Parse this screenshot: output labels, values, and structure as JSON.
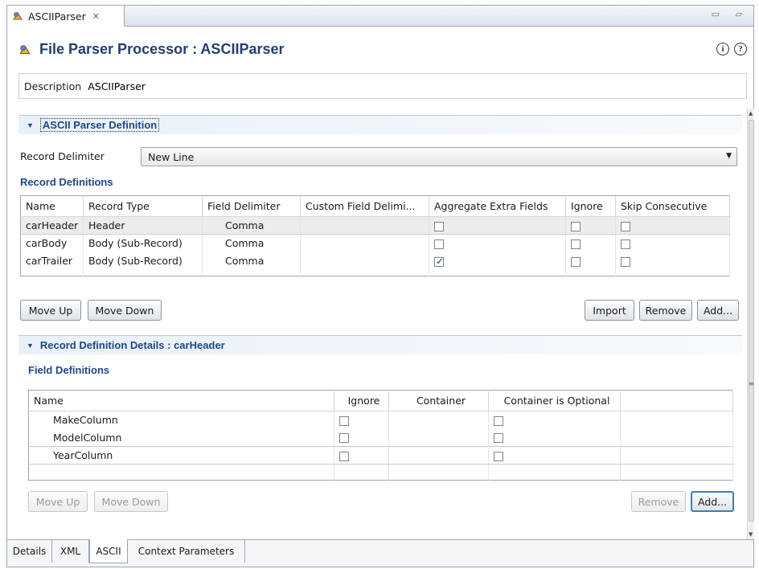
{
  "editor_tab": {
    "label": "ASCIIParser",
    "close_glyph": "✕"
  },
  "window_controls": "▭ ▱",
  "header": {
    "title": "File Parser Processor : ASCIIParser",
    "info_glyph": "i",
    "help_glyph": "?"
  },
  "description": {
    "label": "Description",
    "value": "ASCIIParser"
  },
  "ascii_section": {
    "title": "ASCII Parser Definition",
    "delimiter_label": "Record Delimiter",
    "delimiter_value": "New Line",
    "record_defs_title": "Record Definitions",
    "columns": [
      "Name",
      "Record Type",
      "Field Delimiter",
      "Custom Field Delimi...",
      "Aggregate Extra Fields",
      "Ignore",
      "Skip Consecutive"
    ],
    "rows": [
      {
        "name": "carHeader",
        "type": "Header",
        "delim": "Comma",
        "custom": "",
        "aggregate": false,
        "ignore": false,
        "skip": false
      },
      {
        "name": "carBody",
        "type": "Body (Sub-Record)",
        "delim": "Comma",
        "custom": "",
        "aggregate": false,
        "ignore": false,
        "skip": false
      },
      {
        "name": "carTrailer",
        "type": "Body (Sub-Record)",
        "delim": "Comma",
        "custom": "",
        "aggregate": true,
        "ignore": false,
        "skip": false
      }
    ],
    "buttons": {
      "move_up": "Move Up",
      "move_down": "Move Down",
      "import": "Import",
      "remove": "Remove",
      "add": "Add..."
    }
  },
  "details_section": {
    "title": "Record Definition Details : carHeader",
    "field_defs_title": "Field Definitions",
    "columns": [
      "Name",
      "Ignore",
      "Container",
      "Container is Optional"
    ],
    "rows": [
      {
        "name": "MakeColumn",
        "ignore": false,
        "container": "",
        "optional": false
      },
      {
        "name": "ModelColumn",
        "ignore": false,
        "container": "",
        "optional": false
      },
      {
        "name": "YearColumn",
        "ignore": false,
        "container": "",
        "optional": false
      }
    ],
    "buttons": {
      "move_up": "Move Up",
      "move_down": "Move Down",
      "remove": "Remove",
      "add": "Add..."
    }
  },
  "bottom_tabs": [
    "Details",
    "XML",
    "ASCII",
    "Context Parameters"
  ],
  "active_bottom_tab": "ASCII"
}
